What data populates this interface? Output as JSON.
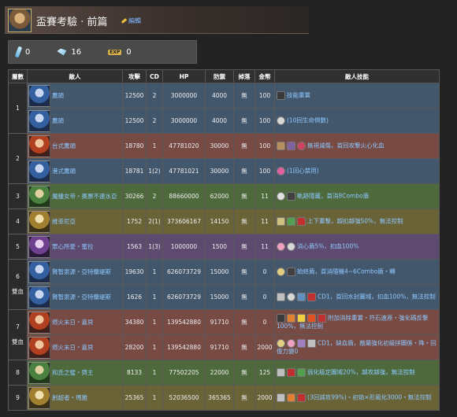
{
  "header": {
    "title": "盃賽考驗 · 前篇",
    "edit_label": "編輯"
  },
  "stats": [
    {
      "icon": "potion-vial-icon",
      "value": "0"
    },
    {
      "icon": "crystal-gem-icon",
      "value": "16"
    },
    {
      "icon": "exp-icon",
      "label": "EXP",
      "value": "0"
    }
  ],
  "table": {
    "headers": [
      "層數",
      "敵人",
      "攻擊",
      "CD",
      "HP",
      "防禦",
      "掉落",
      "金幣",
      "敵人技能"
    ],
    "rows": [
      {
        "floor": "1",
        "floor_span": 2,
        "theme": "blue",
        "pf": "blue",
        "name": "鷹頭",
        "atk": "12500",
        "cd": "2",
        "hp": "3000000",
        "def": "4000",
        "drop": "無",
        "gold": "100",
        "skill": "技能重置",
        "icons": [
          "act-icon"
        ]
      },
      {
        "theme": "blue",
        "pf": "blue",
        "name": "鷹頭",
        "atk": "12500",
        "cd": "2",
        "hp": "3000000",
        "def": "4000",
        "drop": "無",
        "gold": "100",
        "skill": "(10回生命倒數)",
        "icons": [
          "skull-icon"
        ]
      },
      {
        "floor": "2",
        "floor_span": 2,
        "theme": "red",
        "pf": "red",
        "name": "台式鷹頭",
        "atk": "18780",
        "cd": "1",
        "hp": "47781020",
        "def": "30000",
        "drop": "無",
        "gold": "100",
        "skill": "無視減傷，首回攻擊火心化血",
        "icons": [
          "pierce-icon",
          "shield-icon",
          "heart-icon"
        ]
      },
      {
        "theme": "blue",
        "pf": "blue",
        "name": "港式鷹頭",
        "atk": "18781",
        "cd": "1(2)",
        "hp": "47781021",
        "def": "30000",
        "drop": "無",
        "gold": "100",
        "skill": "(1回心禁用)",
        "icons": [
          "heart-lock-icon"
        ]
      },
      {
        "floor": "3",
        "theme": "green",
        "pf": "green",
        "name": "魔腫女帝・奧票不連水亞",
        "atk": "30266",
        "cd": "2",
        "hp": "88660000",
        "def": "62000",
        "drop": "無",
        "gold": "11",
        "skill": "軌跡隱藏，首消8Combo盾",
        "icons": [
          "eye-icon",
          "combo-shield-icon"
        ]
      },
      {
        "floor": "4",
        "theme": "olive",
        "pf": "gold",
        "name": "維菲尼亞",
        "atk": "1752",
        "cd": "2(1)",
        "hp": "373606167",
        "def": "14150",
        "drop": "無",
        "gold": "11",
        "skill": "上下重擊，越扣越強50%，無法控制",
        "icons": [
          "strike-icon",
          "arrow-up-icon",
          "block-icon"
        ]
      },
      {
        "floor": "5",
        "theme": "purple",
        "pf": "purple",
        "name": "眾心所愛・蜜拉",
        "atk": "1563",
        "cd": "1(3)",
        "hp": "1000000",
        "def": "1500",
        "drop": "無",
        "gold": "11",
        "skill": "消心盾5%，扣血100%",
        "icons": [
          "heart-shield-icon",
          "skull-icon"
        ]
      },
      {
        "floor": "6",
        "floor_sub": "雙血",
        "floor_span": 2,
        "theme": "blue",
        "pf": "blue",
        "name": "賢智泉源・亞特蘭堤斯",
        "atk": "19630",
        "cd": "1",
        "hp": "626073729",
        "def": "15000",
        "drop": "無",
        "gold": "0",
        "skill": "始終盾，首消隨機4~6Combo盾・轉",
        "icons": [
          "orb-icon",
          "combo-shield-icon"
        ]
      },
      {
        "theme": "blue",
        "pf": "blue",
        "name": "賢智泉源・亞特蘭堤斯",
        "atk": "1626",
        "cd": "1",
        "hp": "626073729",
        "def": "15000",
        "drop": "無",
        "gold": "0",
        "skill": "CD1，首回水封圖域，扣血100%，無法控制",
        "icons": [
          "sword-icon",
          "skull-icon",
          "lock-icon",
          "block-icon"
        ]
      },
      {
        "floor": "7",
        "floor_sub": "雙血",
        "floor_span": 2,
        "theme": "red",
        "pf": "red",
        "name": "燃火末日・嘉貝",
        "atk": "34380",
        "cd": "1",
        "hp": "139542880",
        "def": "91710",
        "drop": "無",
        "gold": "0",
        "skill": "附加消除重置・符石連原・強化碼反擊100%，無法控制",
        "icons": [
          "act-icon",
          "burst-icon",
          "star-icon",
          "fire-icon",
          "block-icon"
        ]
      },
      {
        "theme": "red",
        "pf": "red",
        "name": "燃火末日・嘉貝",
        "atk": "28200",
        "cd": "1",
        "hp": "139542880",
        "def": "91710",
        "drop": "無",
        "gold": "2000",
        "skill": "CD1，缺血盾，敵屬強化初級拼圖係・降・回復力變0",
        "icons": [
          "orb-icon",
          "heart-shield-icon",
          "grid-icon",
          "sword-icon"
        ]
      },
      {
        "floor": "8",
        "theme": "green",
        "pf": "green",
        "name": "和氏之璧・齊主",
        "atk": "8133",
        "cd": "1",
        "hp": "77502205",
        "def": "22000",
        "drop": "無",
        "gold": "125",
        "skill": "弱化級定圖域20%，越攻越強，無法控制",
        "icons": [
          "sword-icon",
          "block-icon",
          "arrow-up-icon"
        ]
      },
      {
        "floor": "9",
        "theme": "olive",
        "pf": "gold",
        "name": "創超者・瑪雅",
        "atk": "25365",
        "cd": "1",
        "hp": "52036500",
        "def": "365365",
        "drop": "無",
        "gold": "2000",
        "skill": "(3回減攻99%)・初始×形風化3000・無法控制",
        "icons": [
          "sword-icon",
          "burst-icon",
          "block-icon"
        ]
      }
    ]
  },
  "colors": {
    "bg": "#232323",
    "blue": "#43576c",
    "red": "#774a44",
    "green": "#4e6a3c",
    "olive": "#6a6338",
    "purple": "#5e4a6e",
    "link": "#8ec8ff"
  }
}
